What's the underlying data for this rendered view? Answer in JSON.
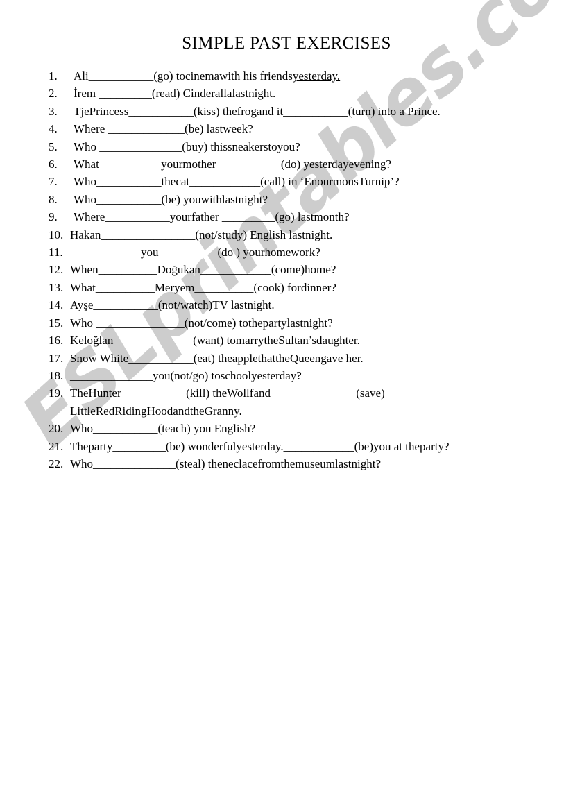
{
  "document": {
    "title": "SIMPLE PAST EXERCISES",
    "watermark": "ESLprintables.com",
    "watermark_color": "#cdcdcd",
    "text_color": "#000000",
    "background_color": "#ffffff"
  },
  "exercises": [
    {
      "number": "1.",
      "text": "Ali___________(go) tocinemawith his friends",
      "underlined_tail": "yesterday."
    },
    {
      "number": "2.",
      "text": "İrem _________(read) Cinderallalastnight."
    },
    {
      "number": "3.",
      "text": "TjePrincess___________(kiss) thefrogand it___________(turn) into a Prince."
    },
    {
      "number": "4.",
      "text": "Where _____________(be) lastweek?"
    },
    {
      "number": "5.",
      "text": "Who ______________(buy) thissneakerstoyou?"
    },
    {
      "number": "6.",
      "text": "What __________yourmother___________(do) yesterdayevening?"
    },
    {
      "number": "7.",
      "text": "Who___________thecat____________(call) in ‘EnourmousTurnip’?"
    },
    {
      "number": "8.",
      "text": "Who___________(be) youwithlastnight?"
    },
    {
      "number": "9.",
      "text": "Where___________yourfather _________(go) lastmonth?"
    },
    {
      "number": "10.",
      "text": "Hakan________________(not/study) English lastnight."
    },
    {
      "number": "11.",
      "text": "____________you__________(do ) yourhomework?"
    },
    {
      "number": "12.",
      "text": "When__________Doğukan____________(come)home?"
    },
    {
      "number": "13.",
      "text": "What__________Meryem__________(cook) fordinner?"
    },
    {
      "number": "14.",
      "text": "Ayşe___________(not/watch)TV lastnight."
    },
    {
      "number": "15.",
      "text": "Who _______________(not/come) tothepartylastnight?"
    },
    {
      "number": "16.",
      "text": "Keloğlan _____________(want) tomarrytheSultan’sdaughter."
    },
    {
      "number": "17.",
      "text": "Snow White___________(eat) theapplethattheQueengave her."
    },
    {
      "number": "18.",
      "text": "______________you(not/go) toschoolyesterday?"
    },
    {
      "number": "19.",
      "text": "TheHunter___________(kill) theWollfand ______________(save)",
      "continuation": "LittleRedRidingHoodandtheGranny."
    },
    {
      "number": "20.",
      "text": "Who___________(teach) you English?"
    },
    {
      "number": "21.",
      "text": "Theparty_________(be) wonderfulyesterday.____________(be)you at theparty?"
    },
    {
      "number": "22.",
      "text": "Who______________(steal) theneclacefromthemuseumlastnight?"
    }
  ]
}
